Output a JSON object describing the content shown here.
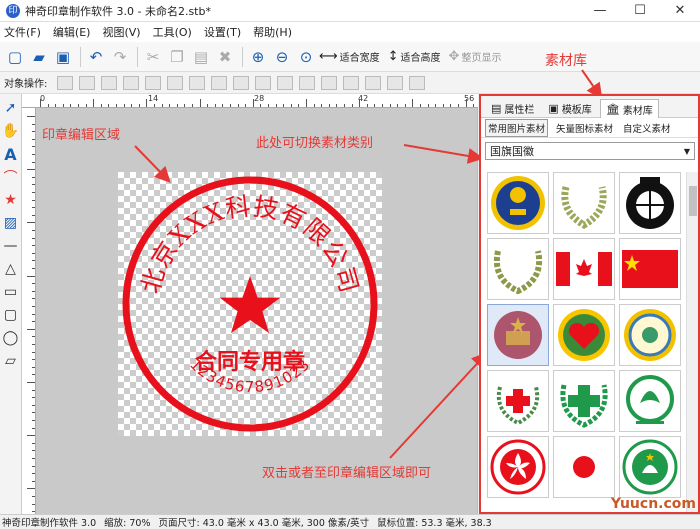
{
  "window": {
    "title": "神奇印章制作软件 3.0 - 未命名2.stb*",
    "icon": "app-logo-icon"
  },
  "window_buttons": {
    "minimize": "—",
    "maximize": "☐",
    "close": "✕"
  },
  "menu": [
    "文件(F)",
    "编辑(E)",
    "视图(V)",
    "工具(O)",
    "设置(T)",
    "帮助(H)"
  ],
  "toolbar": {
    "fit_width": "适合宽度",
    "fit_height": "适合高度",
    "full_page": "整页显示"
  },
  "object_bar": {
    "label": "对象操作:"
  },
  "ruler": {
    "marks": [
      "0",
      "14",
      "28",
      "42",
      "56"
    ]
  },
  "stamp": {
    "company": "北京ⅩⅩⅩ科技有限公司",
    "purpose": "合同专用章",
    "number": "1234567891023",
    "color": "#e8111b"
  },
  "right_panel": {
    "tabs": [
      "属性栏",
      "模板库",
      "素材库"
    ],
    "subtabs": [
      "常用图片素材",
      "矢量图标素材",
      "自定义素材"
    ],
    "category": "国旗国徽"
  },
  "materials": [
    "railway-emblem",
    "laurel-wreath",
    "cctv-globe-emblem",
    "olive-branch-wreath",
    "canada-flag",
    "china-flag",
    "national-emblem",
    "heart-emblem",
    "yellow-badge",
    "red-cross-emblem",
    "green-cross-emblem",
    "green-eco-emblem",
    "hongkong-emblem",
    "japan-flag",
    "macau-emblem"
  ],
  "annotations": {
    "material_library": "素材库",
    "edit_area": "印章编辑区域",
    "switch_category": "此处可切换素材类别",
    "double_click": "双击或者至印章编辑区域即可"
  },
  "status": {
    "app": "神奇印章制作软件 3.0",
    "zoom": "缩放: 70%",
    "page_size": "页面尺寸: 43.0 毫米 x 43.0 毫米, 300 像素/英寸",
    "mouse_pos": "鼠标位置: 53.3 毫米, 38.3"
  },
  "watermark": "Yuucn.com"
}
